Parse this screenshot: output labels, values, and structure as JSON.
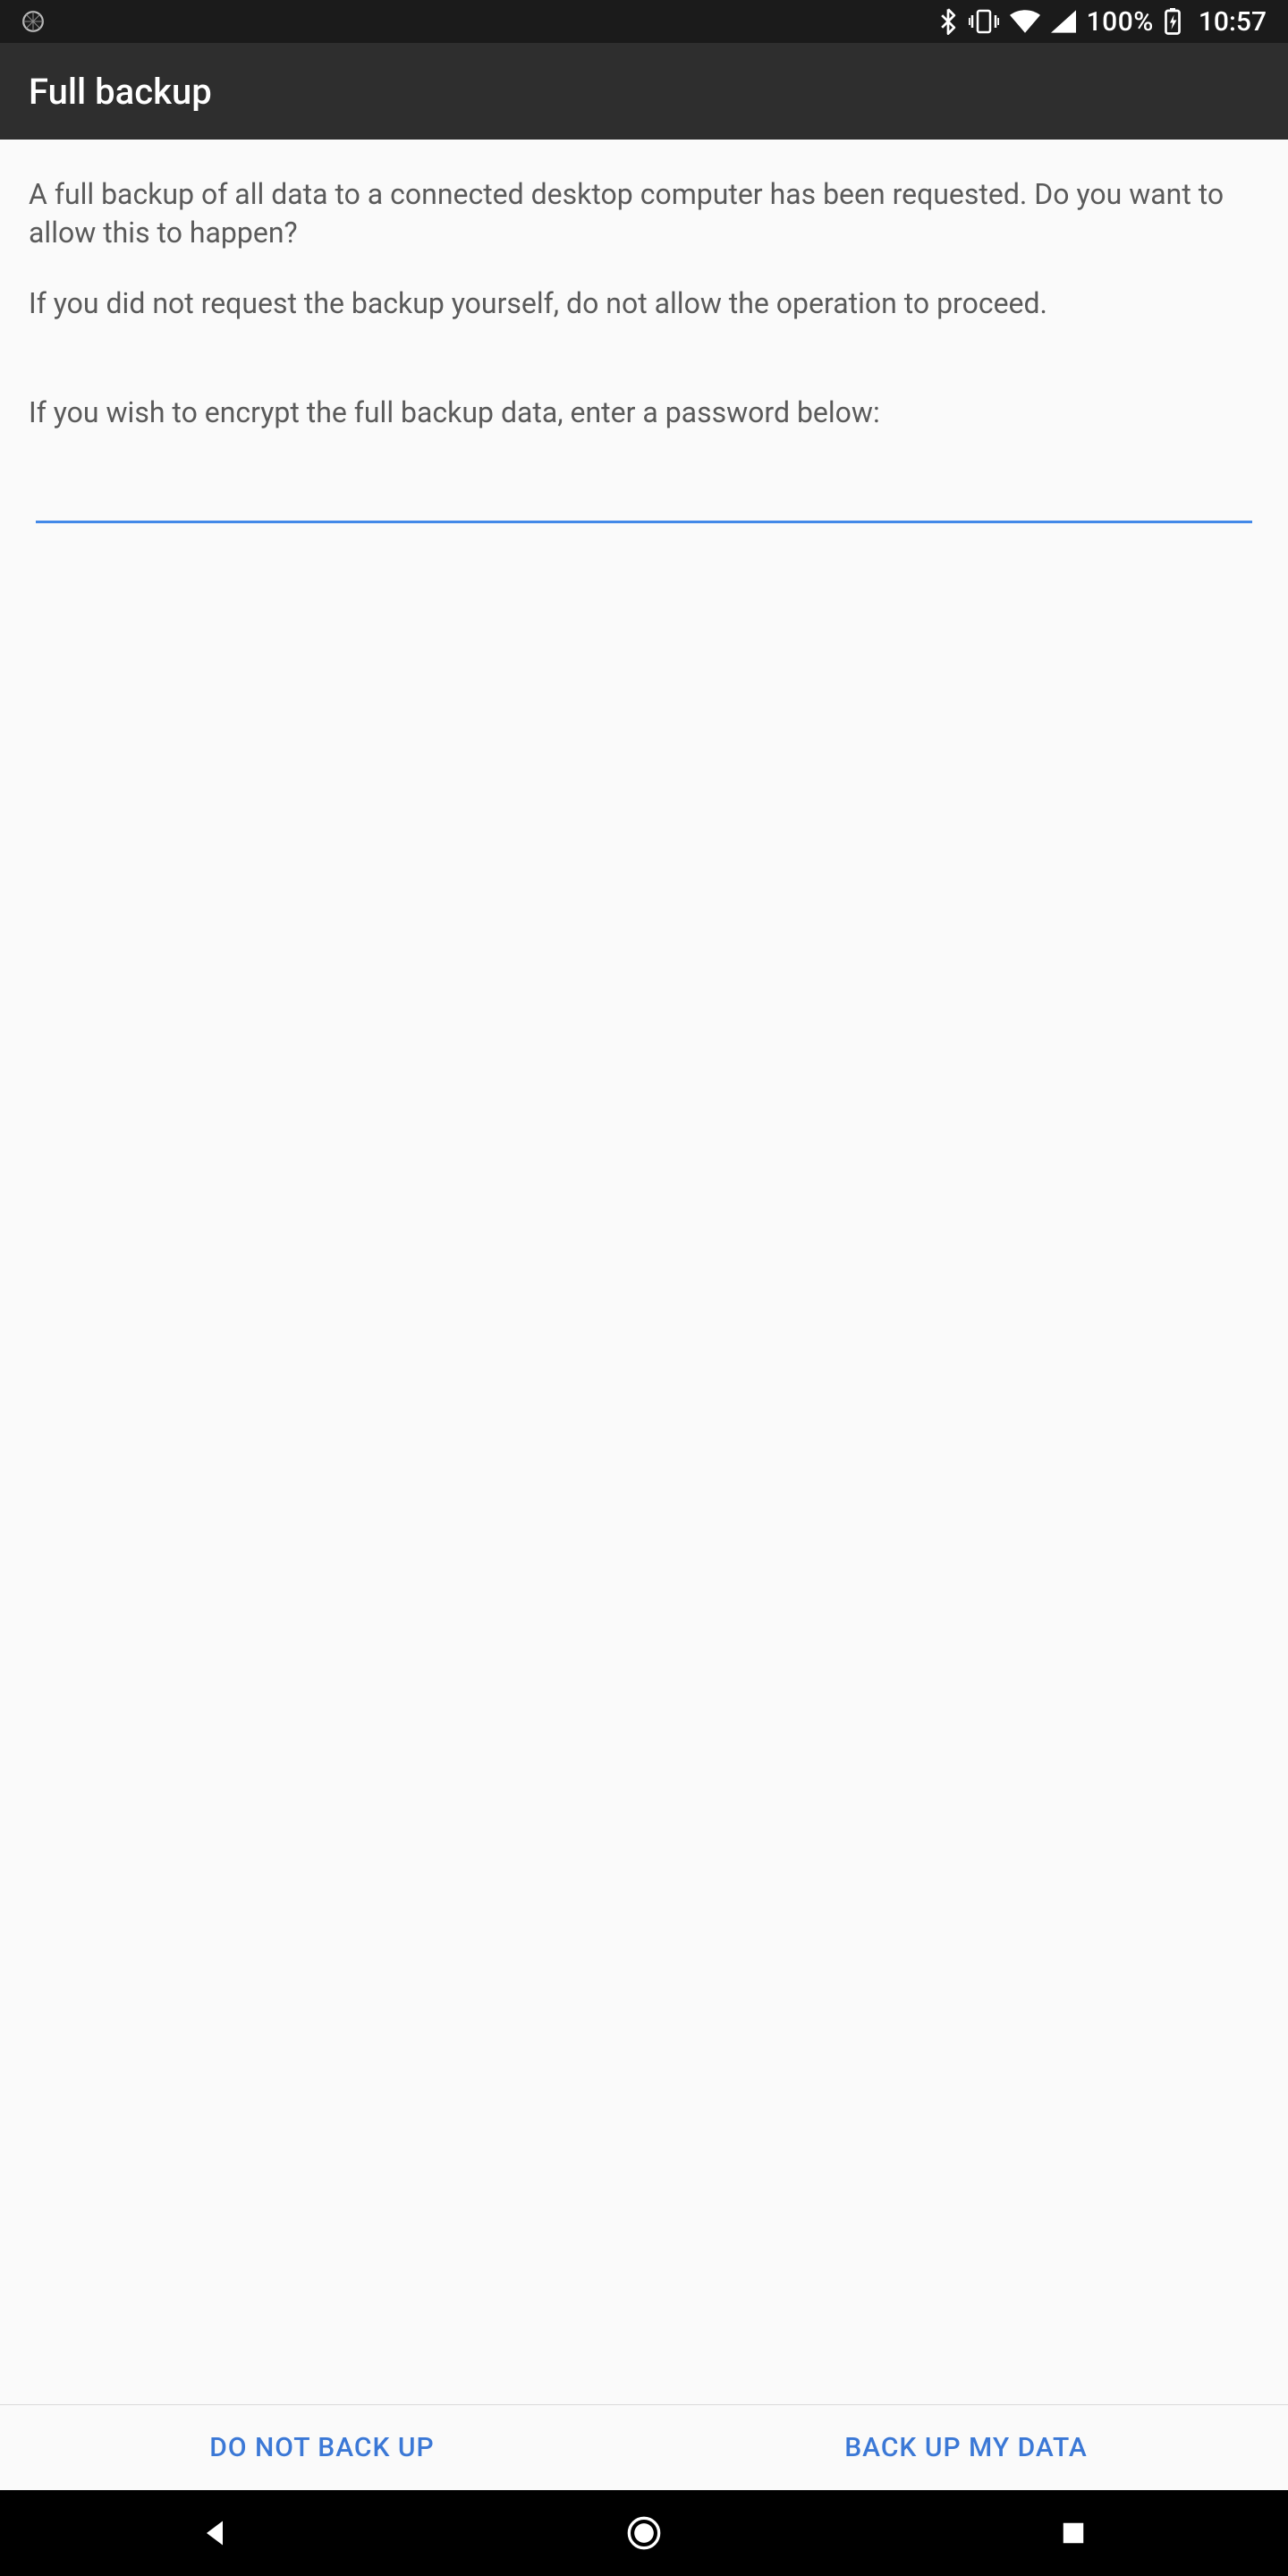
{
  "statusbar": {
    "battery_percent": "100%",
    "time": "10:57"
  },
  "appbar": {
    "title": "Full backup"
  },
  "content": {
    "description_1": "A full backup of all data to a connected desktop computer has been requested. Do you want to allow this to happen?",
    "description_2": "If you did not request the backup yourself, do not allow the operation to proceed.",
    "encrypt_prompt": "If you wish to encrypt the full backup data, enter a password below:",
    "password_value": ""
  },
  "buttons": {
    "deny": "DO NOT BACK UP",
    "allow": "BACK UP MY DATA"
  },
  "icons": {
    "spinner": "loading-spinner",
    "bluetooth": "bluetooth",
    "vibrate": "vibrate",
    "wifi": "wifi",
    "cell": "cellular-signal",
    "battery": "battery-charging"
  }
}
